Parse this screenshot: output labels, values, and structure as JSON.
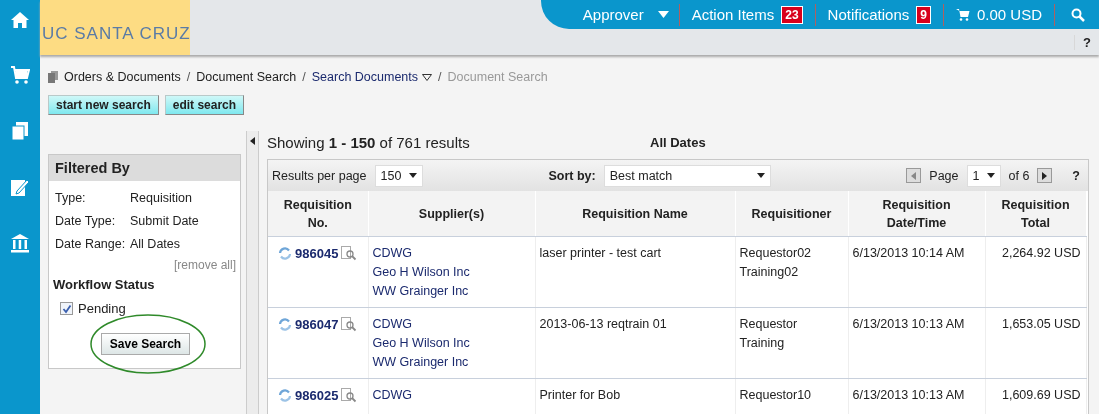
{
  "logo": {
    "text": "UC SANTA CRUZ"
  },
  "top_bar": {
    "role": "Approver",
    "action_items": {
      "label": "Action Items",
      "count": "23"
    },
    "notifications": {
      "label": "Notifications",
      "count": "9"
    },
    "cart_total": "0.00 USD"
  },
  "page_help": "?",
  "breadcrumb": [
    {
      "label": "Orders & Documents",
      "kind": "link"
    },
    {
      "label": "Document Search",
      "kind": "link",
      "sep": "/"
    },
    {
      "label": "Search Documents",
      "kind": "menu",
      "sep": "/"
    },
    {
      "label": "Document Search",
      "kind": "current",
      "sep": "/"
    }
  ],
  "actions": [
    "start new search",
    "edit search"
  ],
  "filter_panel": {
    "title": "Filtered By",
    "filters": [
      {
        "label": "Type:",
        "value": "Requisition"
      },
      {
        "label": "Date Type:",
        "value": "Submit Date"
      },
      {
        "label": "Date Range:",
        "value": "All Dates"
      }
    ],
    "remove_all": "[remove all]",
    "workflow_title": "Workflow Status",
    "options": [
      {
        "label": "Pending",
        "checked": true
      }
    ],
    "save_button": "Save Search"
  },
  "results": {
    "summary": "Showing **1 - 150** of 761 results",
    "date_range": "All Dates",
    "per_page_label": "Results per page",
    "per_page": "150",
    "sort_label": "Sort by:",
    "sort": "Best match",
    "page_label": "Page",
    "page": "1",
    "page_total": "of 6",
    "help": "?",
    "columns": [
      "Requisition No.",
      "Supplier(s)",
      "Requisition Name",
      "Requisitioner",
      "Requisition Date/Time",
      "Requisition Total"
    ],
    "rows": [
      {
        "number": "986045",
        "suppliers": [
          "CDWG",
          "Geo H Wilson Inc",
          "WW Grainger Inc"
        ],
        "name": "laser printer - test cart",
        "requisitioner": [
          "Requestor02",
          "Training02"
        ],
        "date": "6/13/2013 10:14 AM",
        "total": "2,264.92 USD"
      },
      {
        "number": "986047",
        "suppliers": [
          "CDWG",
          "Geo H Wilson Inc",
          "WW Grainger Inc"
        ],
        "name": "2013-06-13 reqtrain 01",
        "requisitioner": [
          "Requestor",
          "Training"
        ],
        "date": "6/13/2013 10:13 AM",
        "total": "1,653.05 USD"
      },
      {
        "number": "986025",
        "suppliers": [
          "CDWG"
        ],
        "name": "Printer for Bob",
        "requisitioner": [
          "Requestor10"
        ],
        "date": "6/13/2013 10:13 AM",
        "total": "1,609.69 USD"
      }
    ]
  }
}
